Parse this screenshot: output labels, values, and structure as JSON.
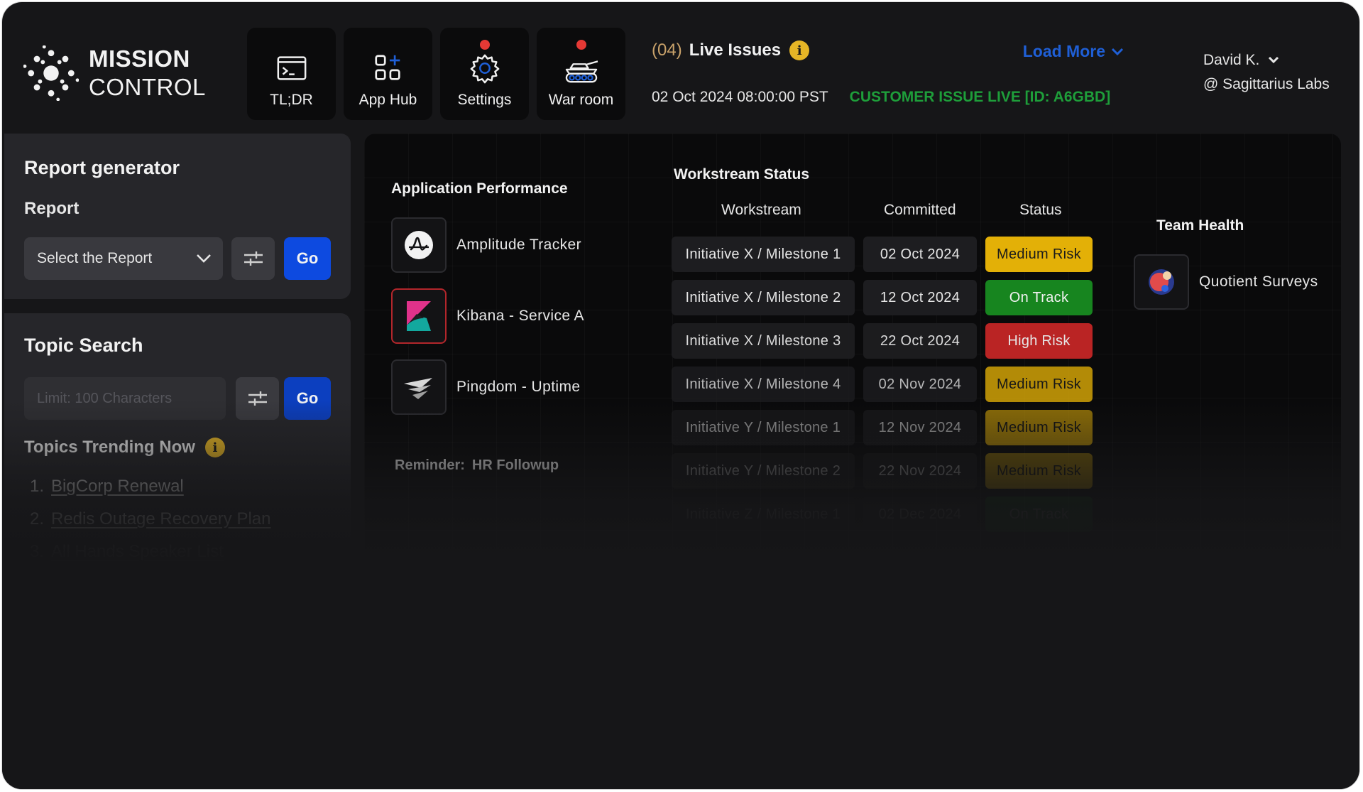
{
  "logo": {
    "line1": "MISSION",
    "line2": "CONTROL"
  },
  "nav": [
    {
      "label": "TL;DR",
      "icon": "terminal-window-icon",
      "dot": false
    },
    {
      "label": "App Hub",
      "icon": "app-grid-icon",
      "dot": false
    },
    {
      "label": "Settings",
      "icon": "gear-icon",
      "dot": true
    },
    {
      "label": "War room",
      "icon": "tank-icon",
      "dot": true
    }
  ],
  "issues": {
    "count": "(04)",
    "title": "Live Issues",
    "info": "i",
    "load_more": "Load More",
    "timestamp": "02 Oct 2024 08:00:00 PST",
    "live_message": "CUSTOMER ISSUE LIVE [ID: A6GBD]"
  },
  "user": {
    "name": "David K.",
    "org": "@ Sagittarius Labs"
  },
  "report": {
    "title": "Report generator",
    "subtitle": "Report",
    "select_value": "Select the Report",
    "go": "Go"
  },
  "topic": {
    "title": "Topic Search",
    "placeholder": "Limit: 100 Characters",
    "go": "Go",
    "trending_title": "Topics Trending Now",
    "trending": [
      {
        "num": "1.",
        "label": "BigCorp Renewal"
      },
      {
        "num": "2.",
        "label": "Redis Outage Recovery Plan"
      },
      {
        "num": "3.",
        "label": "All Hands Speaker List"
      }
    ]
  },
  "app_performance": {
    "title": "Application Performance",
    "apps": [
      {
        "name": "Amplitude Tracker",
        "icon": "amplitude-icon"
      },
      {
        "name": "Kibana - Service A",
        "icon": "kibana-icon"
      },
      {
        "name": "Pingdom - Uptime",
        "icon": "pingdom-icon"
      }
    ],
    "reminder_label": "Reminder:",
    "reminder_value": "HR Followup"
  },
  "workstream": {
    "title": "Workstream Status",
    "headers": {
      "workstream": "Workstream",
      "committed": "Committed",
      "status": "Status"
    },
    "rows": [
      {
        "name": "Initiative X / Milestone 1",
        "date": "02 Oct 2024",
        "status": "Medium Risk",
        "level": "medium",
        "opacity": 1
      },
      {
        "name": "Initiative X / Milestone 2",
        "date": "12 Oct 2024",
        "status": "On Track",
        "level": "ontrack",
        "opacity": 1
      },
      {
        "name": "Initiative X / Milestone 3",
        "date": "22 Oct 2024",
        "status": "High Risk",
        "level": "high",
        "opacity": 0.95
      },
      {
        "name": "Initiative X / Milestone 4",
        "date": "02 Nov 2024",
        "status": "Medium Risk",
        "level": "medium",
        "opacity": 0.78
      },
      {
        "name": "Initiative Y / Milestone 1",
        "date": "12 Nov 2024",
        "status": "Medium Risk",
        "level": "medium",
        "opacity": 0.6
      },
      {
        "name": "Initiative Y / Milestone 2",
        "date": "22 Nov 2024",
        "status": "Medium Risk",
        "level": "medium",
        "opacity": 0.42
      },
      {
        "name": "Initiative Z / Milestone 1",
        "date": "02 Dec 2024",
        "status": "On Track",
        "level": "ontrack",
        "opacity": 0.22
      }
    ]
  },
  "team_health": {
    "title": "Team Health",
    "item": {
      "name": "Quotient Surveys",
      "icon": "quotient-icon"
    }
  },
  "colors": {
    "accent_blue": "#0d4ae0",
    "link_blue": "#1f5fd6",
    "live_green": "#1e9e3a",
    "medium": "#e3b007",
    "ontrack": "#17851f",
    "high": "#c42626",
    "dot_red": "#e53935"
  }
}
